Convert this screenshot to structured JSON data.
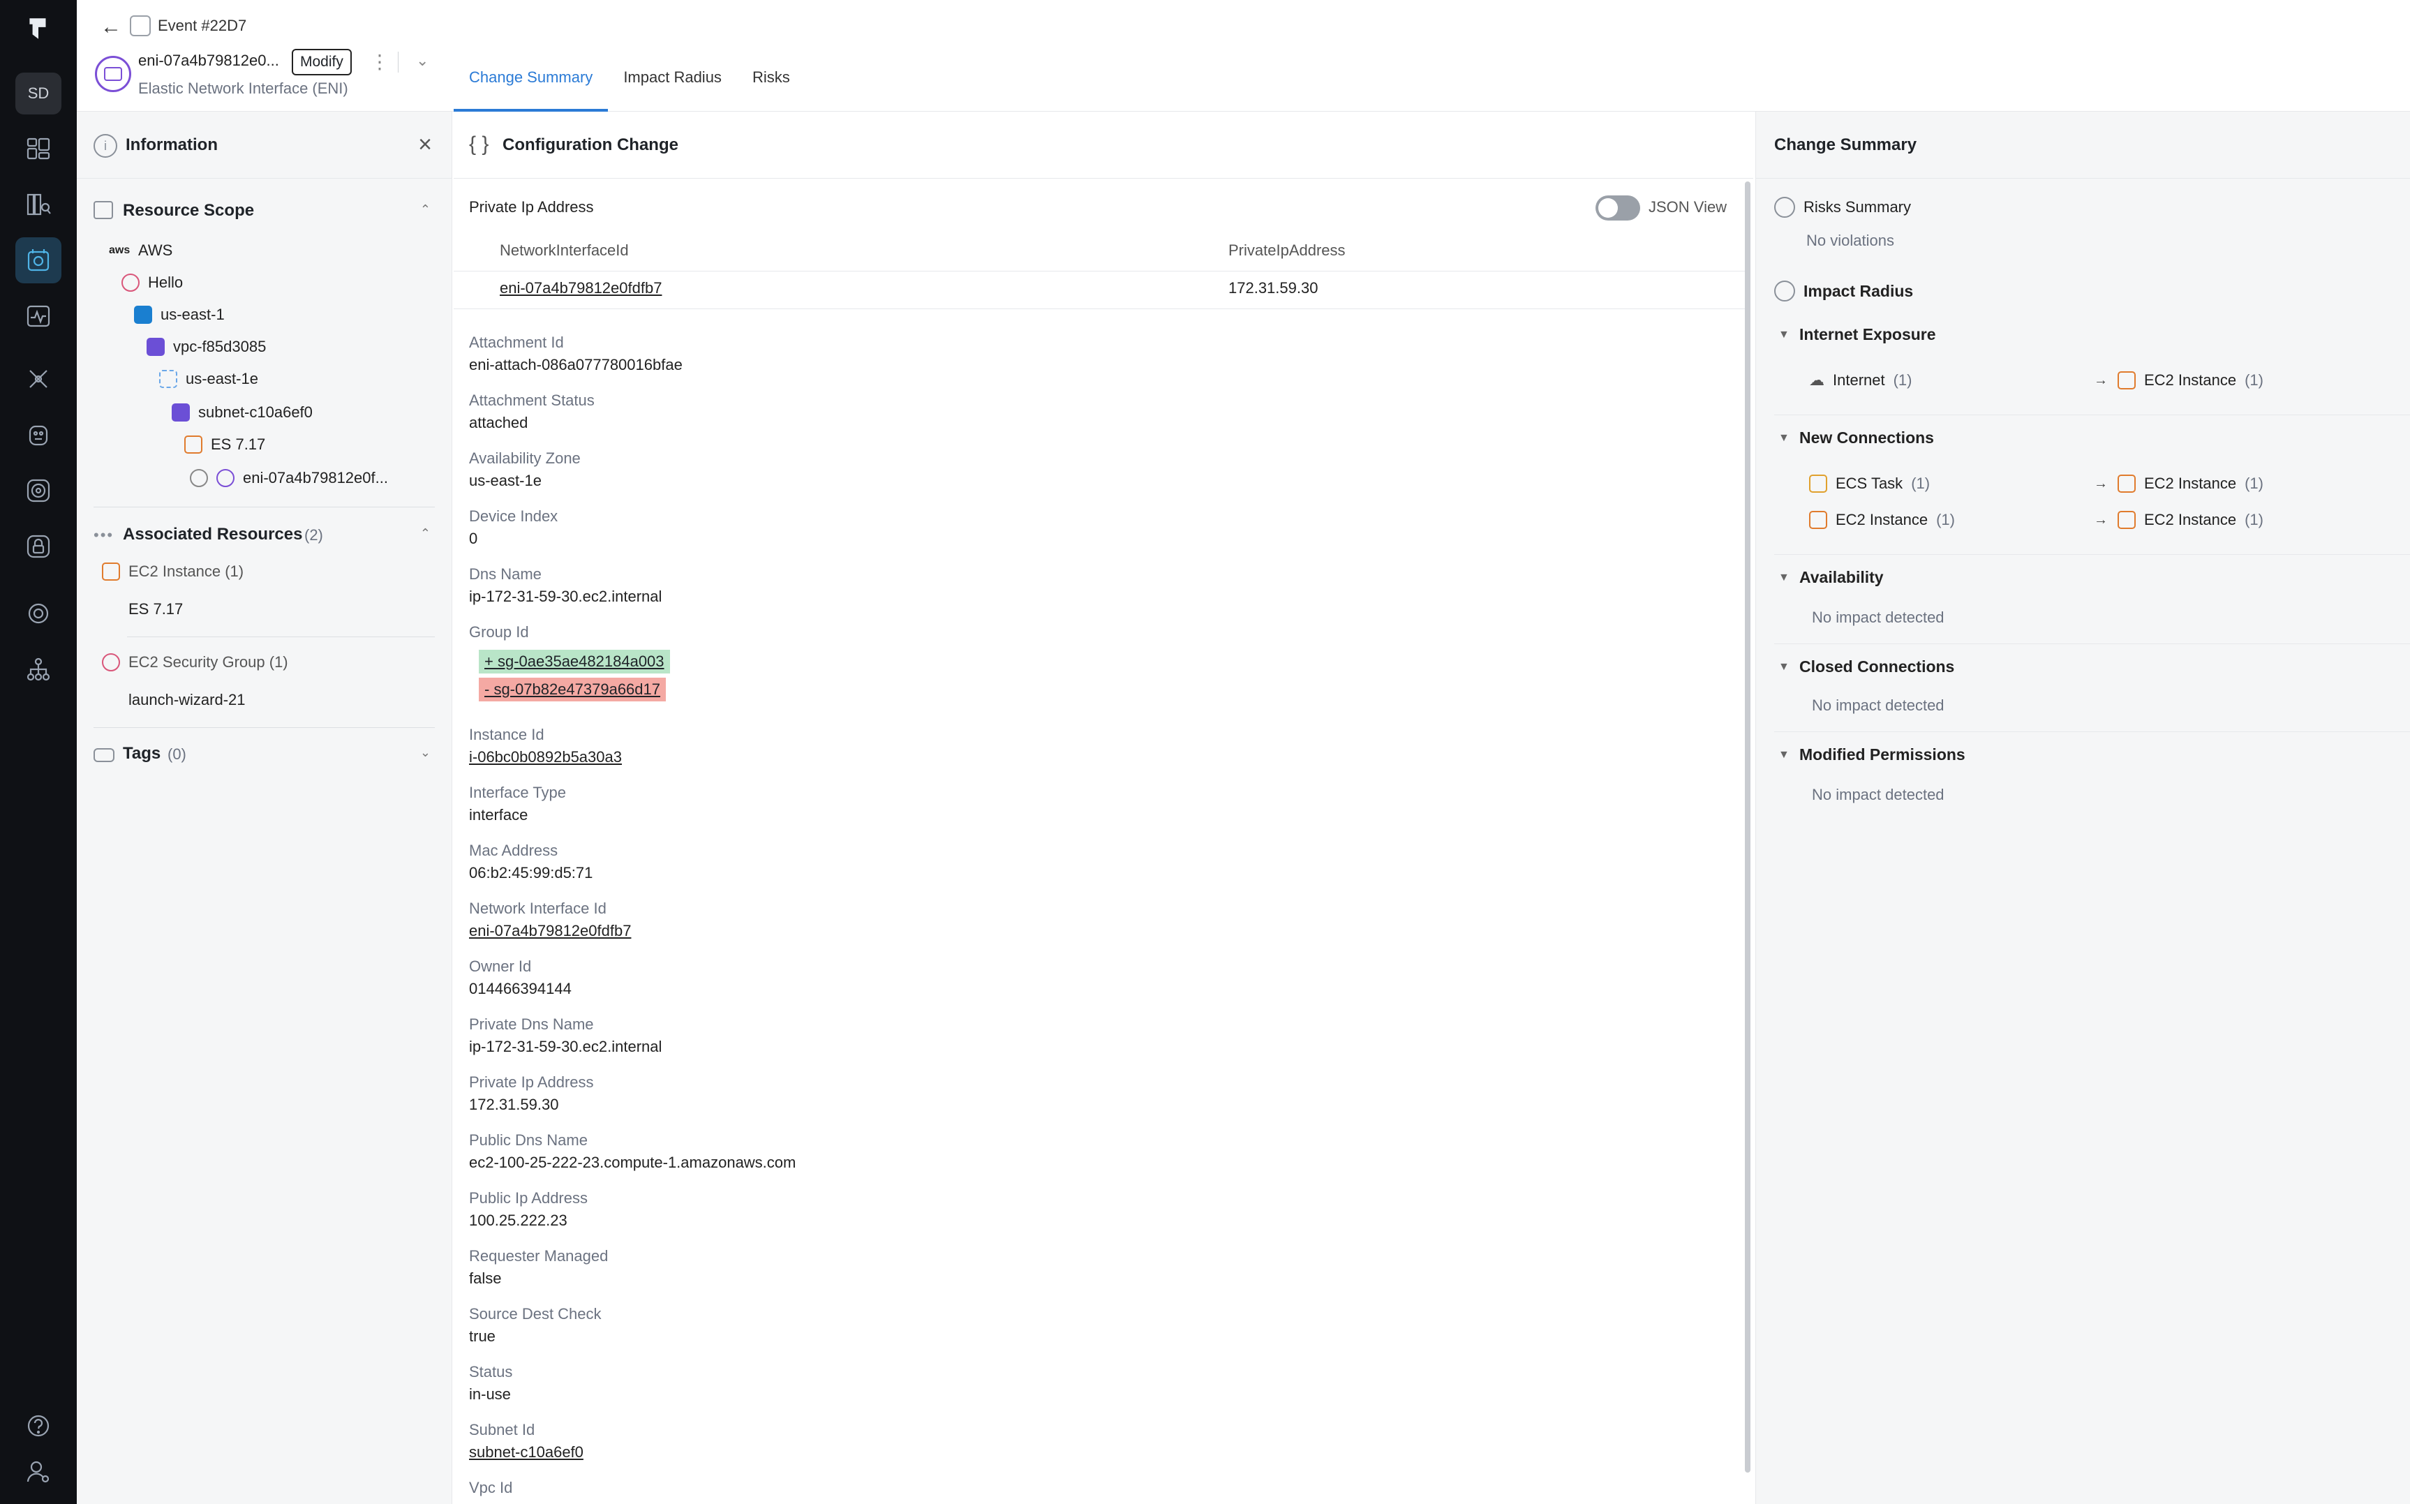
{
  "rail": {
    "avatar": "SD"
  },
  "header": {
    "breadcrumb": "Event #22D7",
    "resource_name": "eni-07a4b79812e0...",
    "modify_label": "Modify",
    "resource_type": "Elastic Network Interface (ENI)",
    "tabs": [
      "Change Summary",
      "Impact Radius",
      "Risks"
    ]
  },
  "info": {
    "title": "Information",
    "scope_title": "Resource Scope",
    "tree": [
      {
        "label": "AWS",
        "icon": "aws-logo"
      },
      {
        "label": "Hello",
        "icon": "account-icon"
      },
      {
        "label": "us-east-1",
        "icon": "region-icon"
      },
      {
        "label": "vpc-f85d3085",
        "icon": "vpc-icon"
      },
      {
        "label": "us-east-1e",
        "icon": "availability-zone-icon"
      },
      {
        "label": "subnet-c10a6ef0",
        "icon": "subnet-icon"
      },
      {
        "label": "ES 7.17",
        "icon": "ec2-instance-icon"
      },
      {
        "label": "eni-07a4b79812e0f...",
        "icon": "eni-icon"
      }
    ],
    "assoc_title": "Associated Resources",
    "assoc_count": "(2)",
    "assoc": [
      {
        "type": "EC2 Instance (1)",
        "item": "ES 7.17"
      },
      {
        "type": "EC2 Security Group (1)",
        "item": "launch-wizard-21"
      }
    ],
    "tags_title": "Tags",
    "tags_count": "(0)"
  },
  "config": {
    "title": "Configuration Change",
    "table_title": "Private Ip Address",
    "json_view": "JSON View",
    "columns": [
      "NetworkInterfaceId",
      "PrivateIpAddress"
    ],
    "row": [
      "eni-07a4b79812e0fdfb7",
      "172.31.59.30"
    ],
    "fields": [
      {
        "label": "Attachment Id",
        "value": "eni-attach-086a077780016bfae"
      },
      {
        "label": "Attachment Status",
        "value": "attached"
      },
      {
        "label": "Availability Zone",
        "value": "us-east-1e"
      },
      {
        "label": "Device Index",
        "value": "0"
      },
      {
        "label": "Dns Name",
        "value": "ip-172-31-59-30.ec2.internal"
      },
      {
        "label": "Group Id",
        "added": "+ sg-0ae35ae482184a003",
        "removed": "- sg-07b82e47379a66d17"
      },
      {
        "label": "Instance Id",
        "value": "i-06bc0b0892b5a30a3"
      },
      {
        "label": "Interface Type",
        "value": "interface"
      },
      {
        "label": "Mac Address",
        "value": "06:b2:45:99:d5:71"
      },
      {
        "label": "Network Interface Id",
        "value": "eni-07a4b79812e0fdfb7"
      },
      {
        "label": "Owner Id",
        "value": "014466394144"
      },
      {
        "label": "Private Dns Name",
        "value": "ip-172-31-59-30.ec2.internal"
      },
      {
        "label": "Private Ip Address",
        "value": "172.31.59.30"
      },
      {
        "label": "Public Dns Name",
        "value": "ec2-100-25-222-23.compute-1.amazonaws.com"
      },
      {
        "label": "Public Ip Address",
        "value": "100.25.222.23"
      },
      {
        "label": "Requester Managed",
        "value": "false"
      },
      {
        "label": "Source Dest Check",
        "value": "true"
      },
      {
        "label": "Status",
        "value": "in-use"
      },
      {
        "label": "Subnet Id",
        "value": "subnet-c10a6ef0"
      },
      {
        "label": "Vpc Id",
        "value": ""
      }
    ]
  },
  "summary": {
    "title": "Change Summary",
    "risks_title": "Risks Summary",
    "risks_value": "No violations",
    "impact_title": "Impact Radius",
    "internet_title": "Internet Exposure",
    "internet_from": "Internet",
    "internet_from_count": "(1)",
    "internet_to": "EC2 Instance",
    "internet_to_count": "(1)",
    "new_conn_title": "New Connections",
    "new_conn": [
      {
        "from": "ECS Task",
        "from_count": "(1)",
        "to": "EC2 Instance",
        "to_count": "(1)"
      },
      {
        "from": "EC2 Instance",
        "from_count": "(1)",
        "to": "EC2 Instance",
        "to_count": "(1)"
      }
    ],
    "availability_title": "Availability",
    "availability_value": "No impact detected",
    "closed_title": "Closed Connections",
    "closed_value": "No impact detected",
    "perm_title": "Modified Permissions",
    "perm_value": "No impact detected"
  }
}
